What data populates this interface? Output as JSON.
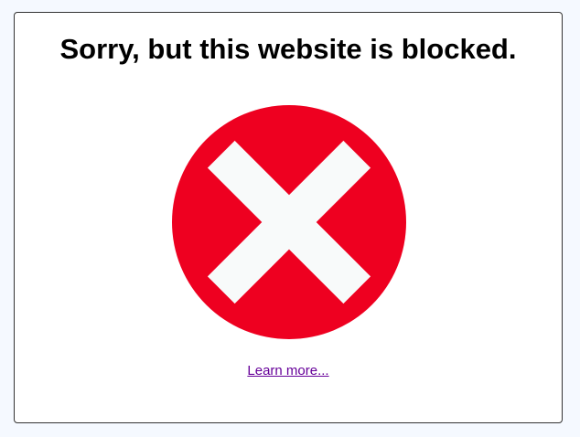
{
  "page": {
    "background_color": "#f5f9ff"
  },
  "card": {
    "title": "Sorry, but this website is blocked.",
    "icon": "blocked-x-circle-icon",
    "icon_colors": {
      "circle": "#ee0020",
      "cross": "#f8fafa"
    },
    "link_label": "Learn more...",
    "link_color": "#660099"
  }
}
